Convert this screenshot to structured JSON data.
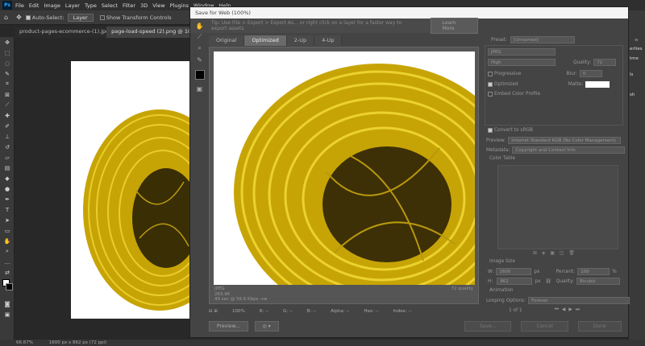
{
  "menubar": {
    "logo": "Ps",
    "items": [
      "File",
      "Edit",
      "Image",
      "Layer",
      "Type",
      "Select",
      "Filter",
      "3D",
      "View",
      "Plugins",
      "Window",
      "Help"
    ]
  },
  "options": {
    "auto_select_label": "Auto-Select:",
    "layer_select": "Layer",
    "transform_label": "Show Transform Controls"
  },
  "doc_tabs": [
    "product-pages-ecommerce-(1).jpg",
    "page-load-speed (2).png @ 10"
  ],
  "right_panel": {
    "labels": [
      "erties",
      "tme",
      "ls",
      "sh"
    ]
  },
  "status": {
    "zoom": "66.67%",
    "size": "1600 px x 862 px (72 ppi)"
  },
  "dialog": {
    "title": "Save for Web (100%)",
    "tip": "Tip: Use File > Export > Export As...  or right click on a layer for a faster way to export assets",
    "learn_more": "Learn More",
    "view_tabs": [
      "Original",
      "Optimized",
      "2-Up",
      "4-Up"
    ],
    "info_left": [
      "JPEG",
      "263.9K",
      "49 sec @ 56.6 Kbps  →≡"
    ],
    "info_right": "72 quality",
    "bottom": {
      "zoom": "100%",
      "r": "R: --",
      "g": "G: --",
      "b": "B: --",
      "alpha": "Alpha: --",
      "hex": "Hex: --",
      "index": "Index: --"
    },
    "preview_btn": "Preview...",
    "buttons": {
      "save": "Save...",
      "cancel": "Cancel",
      "done": "Done"
    },
    "settings": {
      "preset_label": "Preset:",
      "preset_value": "[Unnamed]",
      "format": "JPEG",
      "quality_level": "High",
      "quality_label": "Quality:",
      "quality_value": "72",
      "progressive": "Progressive",
      "blur_label": "Blur:",
      "blur_value": "0",
      "optimized": "Optimized",
      "matte_label": "Matte:",
      "embed": "Embed Color Profile",
      "convert": "Convert to sRGB",
      "preview_label": "Preview:",
      "preview_value": "Internet Standard RGB (No Color Management)",
      "metadata_label": "Metadata:",
      "metadata_value": "Copyright and Contact Info",
      "color_table": "Color Table",
      "image_size": "Image Size",
      "w_label": "W:",
      "w_value": "1600",
      "h_label": "H:",
      "h_value": "862",
      "px": "px",
      "percent_label": "Percent:",
      "percent_value": "100",
      "pct": "%",
      "quality2_label": "Quality:",
      "quality2_value": "Bicubic",
      "animation": "Animation",
      "looping_label": "Looping Options:",
      "looping_value": "Forever",
      "frame": "1 of 1"
    }
  }
}
